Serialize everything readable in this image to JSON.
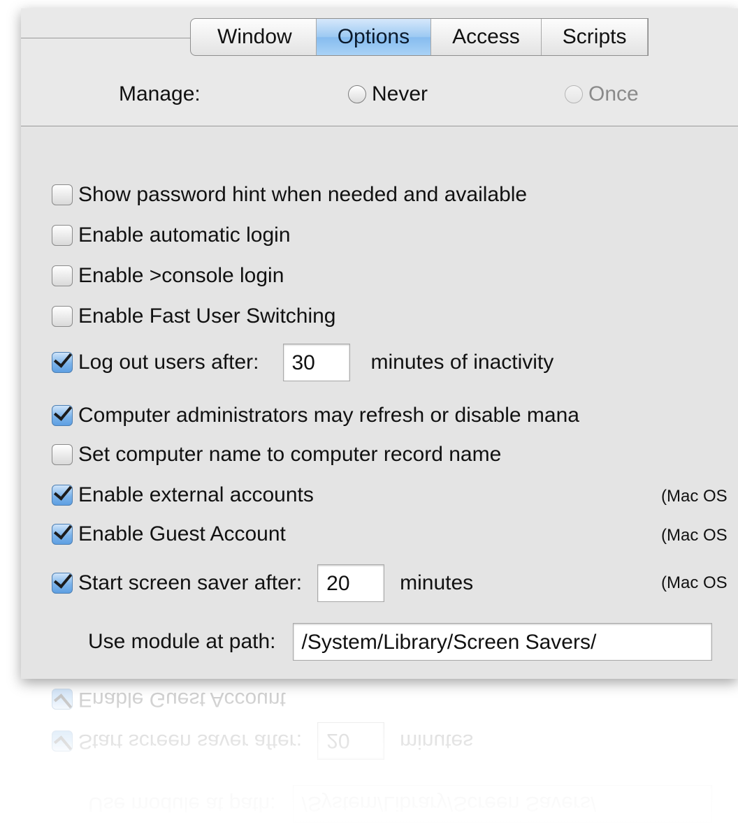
{
  "tabs": [
    {
      "label": "Window",
      "selected": false
    },
    {
      "label": "Options",
      "selected": true
    },
    {
      "label": "Access",
      "selected": false
    },
    {
      "label": "Scripts",
      "selected": false
    }
  ],
  "manage": {
    "label": "Manage:",
    "options": [
      {
        "label": "Never",
        "enabled": true
      },
      {
        "label": "Once",
        "enabled": false
      }
    ]
  },
  "options": {
    "show_hint": {
      "label": "Show password hint when needed and available",
      "checked": false
    },
    "auto_login": {
      "label": "Enable automatic login",
      "checked": false
    },
    "console_login": {
      "label": "Enable >console login",
      "checked": false
    },
    "fast_switching": {
      "label": "Enable Fast User Switching",
      "checked": false
    },
    "logout": {
      "label": "Log out users after:",
      "value": "30",
      "suffix": "minutes of inactivity",
      "checked": true
    },
    "admin_refresh": {
      "label": "Computer administrators may refresh or disable mana",
      "checked": true
    },
    "computer_name": {
      "label": "Set computer name to computer record name",
      "checked": false
    },
    "external_accounts": {
      "label": "Enable external accounts",
      "note": "(Mac OS",
      "checked": true
    },
    "guest_account": {
      "label": "Enable Guest Account",
      "note": "(Mac OS",
      "checked": true
    },
    "screensaver": {
      "label": "Start screen saver after:",
      "value": "20",
      "suffix": "minutes",
      "note": "(Mac OS",
      "checked": true
    },
    "module_path": {
      "label": "Use module at path:",
      "value": "/System/Library/Screen Savers/"
    }
  },
  "colors": {
    "panel_bg": "#e4e4e4",
    "tab_selected": "#9cc9f2",
    "checkbox_checked": "#7db4ea"
  }
}
